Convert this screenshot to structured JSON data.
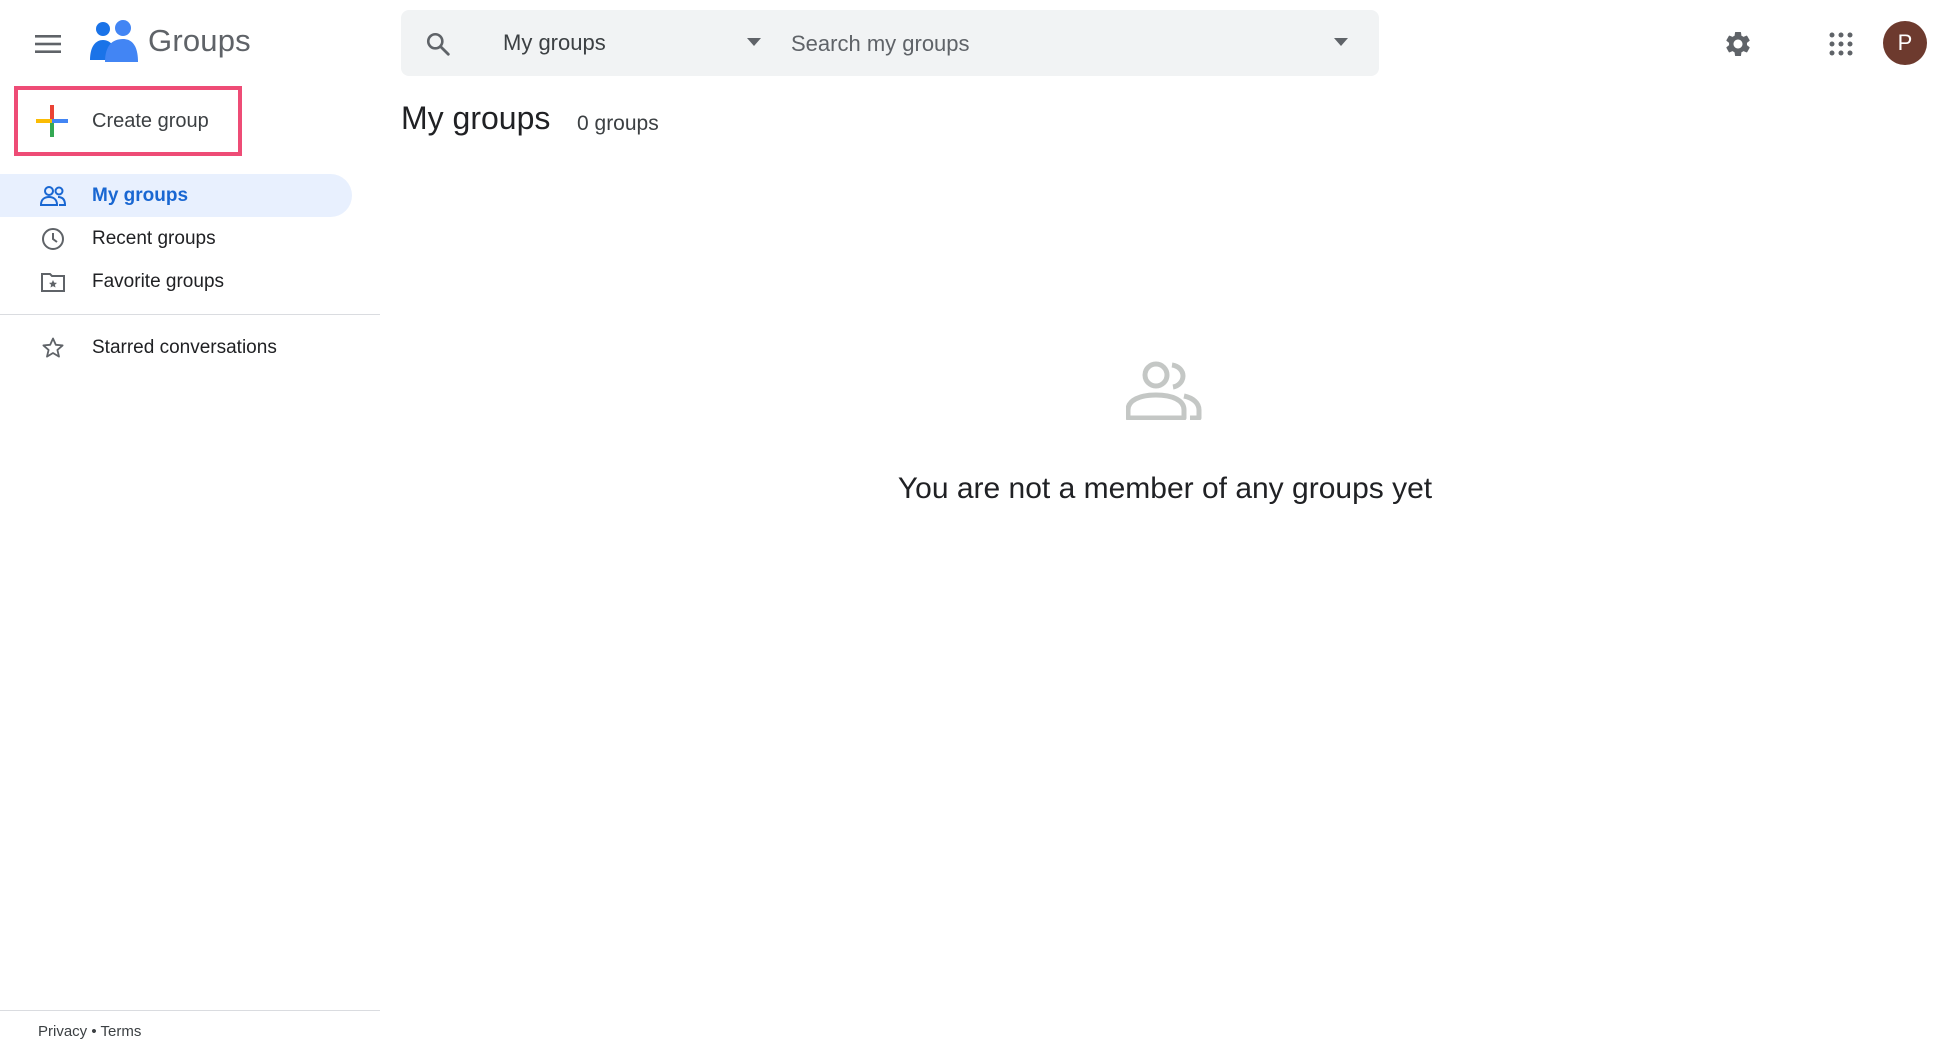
{
  "header": {
    "app_name": "Groups",
    "search": {
      "scope_label": "My groups",
      "placeholder": "Search my groups"
    },
    "avatar_initial": "P"
  },
  "sidebar": {
    "create_label": "Create group",
    "items": [
      {
        "label": "My groups",
        "icon": "people-icon",
        "active": true
      },
      {
        "label": "Recent groups",
        "icon": "clock-icon",
        "active": false
      },
      {
        "label": "Favorite groups",
        "icon": "star-folder-icon",
        "active": false
      }
    ],
    "secondary_items": [
      {
        "label": "Starred conversations",
        "icon": "star-icon"
      }
    ],
    "footer": {
      "privacy": "Privacy",
      "separator": "•",
      "terms": "Terms"
    }
  },
  "main": {
    "title": "My groups",
    "count": "0 groups",
    "empty_message": "You are not a member of any groups yet"
  },
  "colors": {
    "accent": "#1967d2",
    "active_bg": "#e8f0fe",
    "highlight_border": "#ee4c76",
    "avatar_bg": "#6d3a2e"
  }
}
